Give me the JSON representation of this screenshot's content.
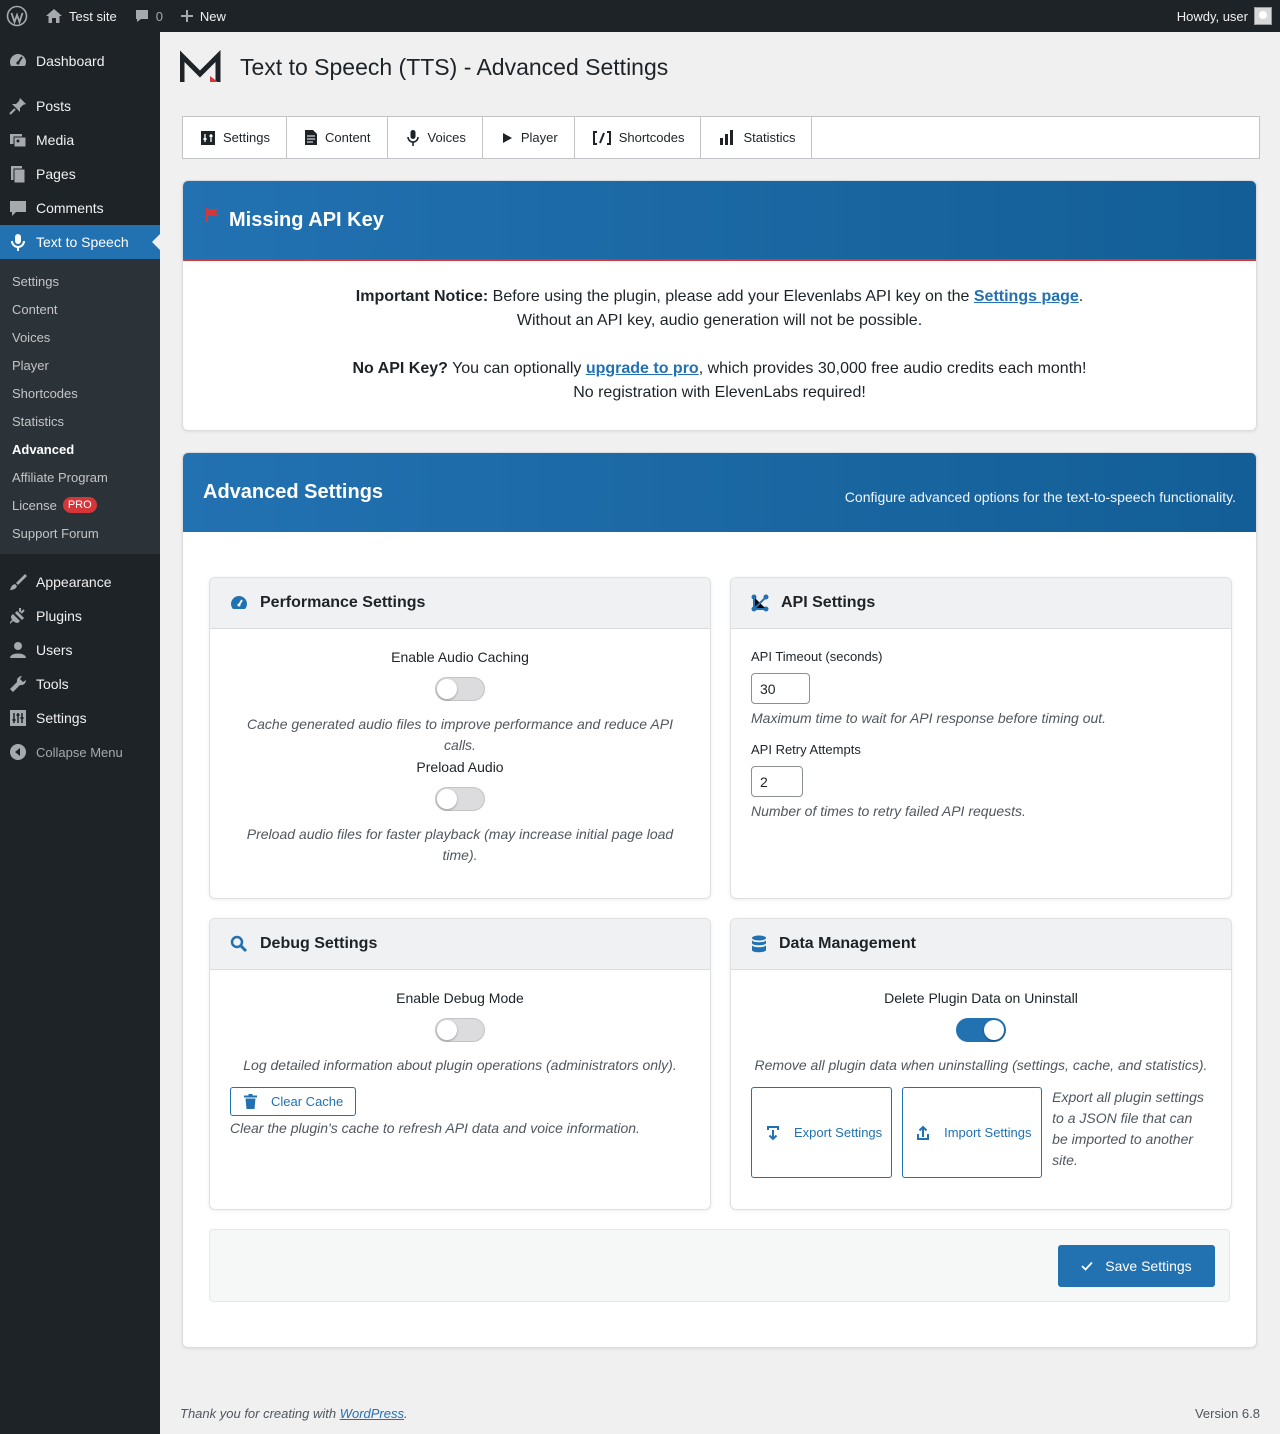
{
  "adminbar": {
    "site_name": "Test site",
    "comments_count": "0",
    "new_label": "New",
    "howdy": "Howdy, user"
  },
  "sidebar": {
    "top_items": [
      {
        "label": "Dashboard",
        "icon": "dashboard-icon"
      }
    ],
    "items": [
      {
        "label": "Posts",
        "icon": "pin-icon"
      },
      {
        "label": "Media",
        "icon": "media-icon"
      },
      {
        "label": "Pages",
        "icon": "pages-icon"
      },
      {
        "label": "Comments",
        "icon": "comment-icon"
      },
      {
        "label": "Text to Speech",
        "icon": "microphone-icon",
        "active": true
      }
    ],
    "submenu": [
      "Settings",
      "Content",
      "Voices",
      "Player",
      "Shortcodes",
      "Statistics",
      "Advanced",
      "Affiliate Program",
      "License",
      "Support Forum"
    ],
    "submenu_current": "Advanced",
    "license_badge": "PRO",
    "lower_items": [
      "Appearance",
      "Plugins",
      "Users",
      "Tools",
      "Settings"
    ],
    "collapse_label": "Collapse Menu"
  },
  "page": {
    "title": "Text to Speech (TTS) - Advanced Settings"
  },
  "tabs": [
    {
      "label": "Settings",
      "icon": "settings-tab-icon"
    },
    {
      "label": "Content",
      "icon": "document-icon"
    },
    {
      "label": "Voices",
      "icon": "microphone-icon"
    },
    {
      "label": "Player",
      "icon": "play-icon"
    },
    {
      "label": "Shortcodes",
      "icon": "shortcode-icon"
    },
    {
      "label": "Statistics",
      "icon": "bar-chart-icon"
    }
  ],
  "notice": {
    "title": "Missing API Key",
    "line1_bold": "Important Notice:",
    "line1_text": " Before using the plugin, please add your Elevenlabs API key on the ",
    "line1_link": "Settings page",
    "line1_end": ".",
    "line2": "Without an API key, audio generation will not be possible.",
    "line3_bold": "No API Key?",
    "line3_text": " You can optionally ",
    "line3_link": "upgrade to pro",
    "line3_end": ", which provides 30,000 free audio credits each month!",
    "line4": "No registration with ElevenLabs required!"
  },
  "advanced": {
    "title": "Advanced Settings",
    "subtitle": "Configure advanced options for the text-to-speech functionality."
  },
  "performance": {
    "title": "Performance Settings",
    "caching_label": "Enable Audio Caching",
    "caching_on": false,
    "caching_desc": "Cache generated audio files to improve performance and reduce API calls.",
    "preload_label": "Preload Audio",
    "preload_on": false,
    "preload_desc": "Preload audio files for faster playback (may increase initial page load time)."
  },
  "api": {
    "title": "API Settings",
    "timeout_label": "API Timeout (seconds)",
    "timeout_value": "30",
    "timeout_desc": "Maximum time to wait for API response before timing out.",
    "retry_label": "API Retry Attempts",
    "retry_value": "2",
    "retry_desc": "Number of times to retry failed API requests."
  },
  "debug": {
    "title": "Debug Settings",
    "debug_label": "Enable Debug Mode",
    "debug_on": false,
    "debug_desc": "Log detailed information about plugin operations (administrators only).",
    "clear_cache_label": "Clear Cache",
    "clear_cache_desc": "Clear the plugin's cache to refresh API data and voice information."
  },
  "data_mgmt": {
    "title": "Data Management",
    "delete_label": "Delete Plugin Data on Uninstall",
    "delete_on": true,
    "delete_desc": "Remove all plugin data when uninstalling (settings, cache, and statistics).",
    "export_label": "Export Settings",
    "import_label": "Import Settings",
    "export_desc": "Export all plugin settings to a JSON file that can be imported to another site."
  },
  "save_label": "Save Settings",
  "footer": {
    "thanks_text": "Thank you for creating with ",
    "wp_link": "WordPress",
    "thanks_end": ".",
    "version": "Version 6.8"
  },
  "colors": {
    "accent": "#2271b1",
    "sidebar_bg": "#1d2327",
    "notice_flag": "#d63638"
  }
}
